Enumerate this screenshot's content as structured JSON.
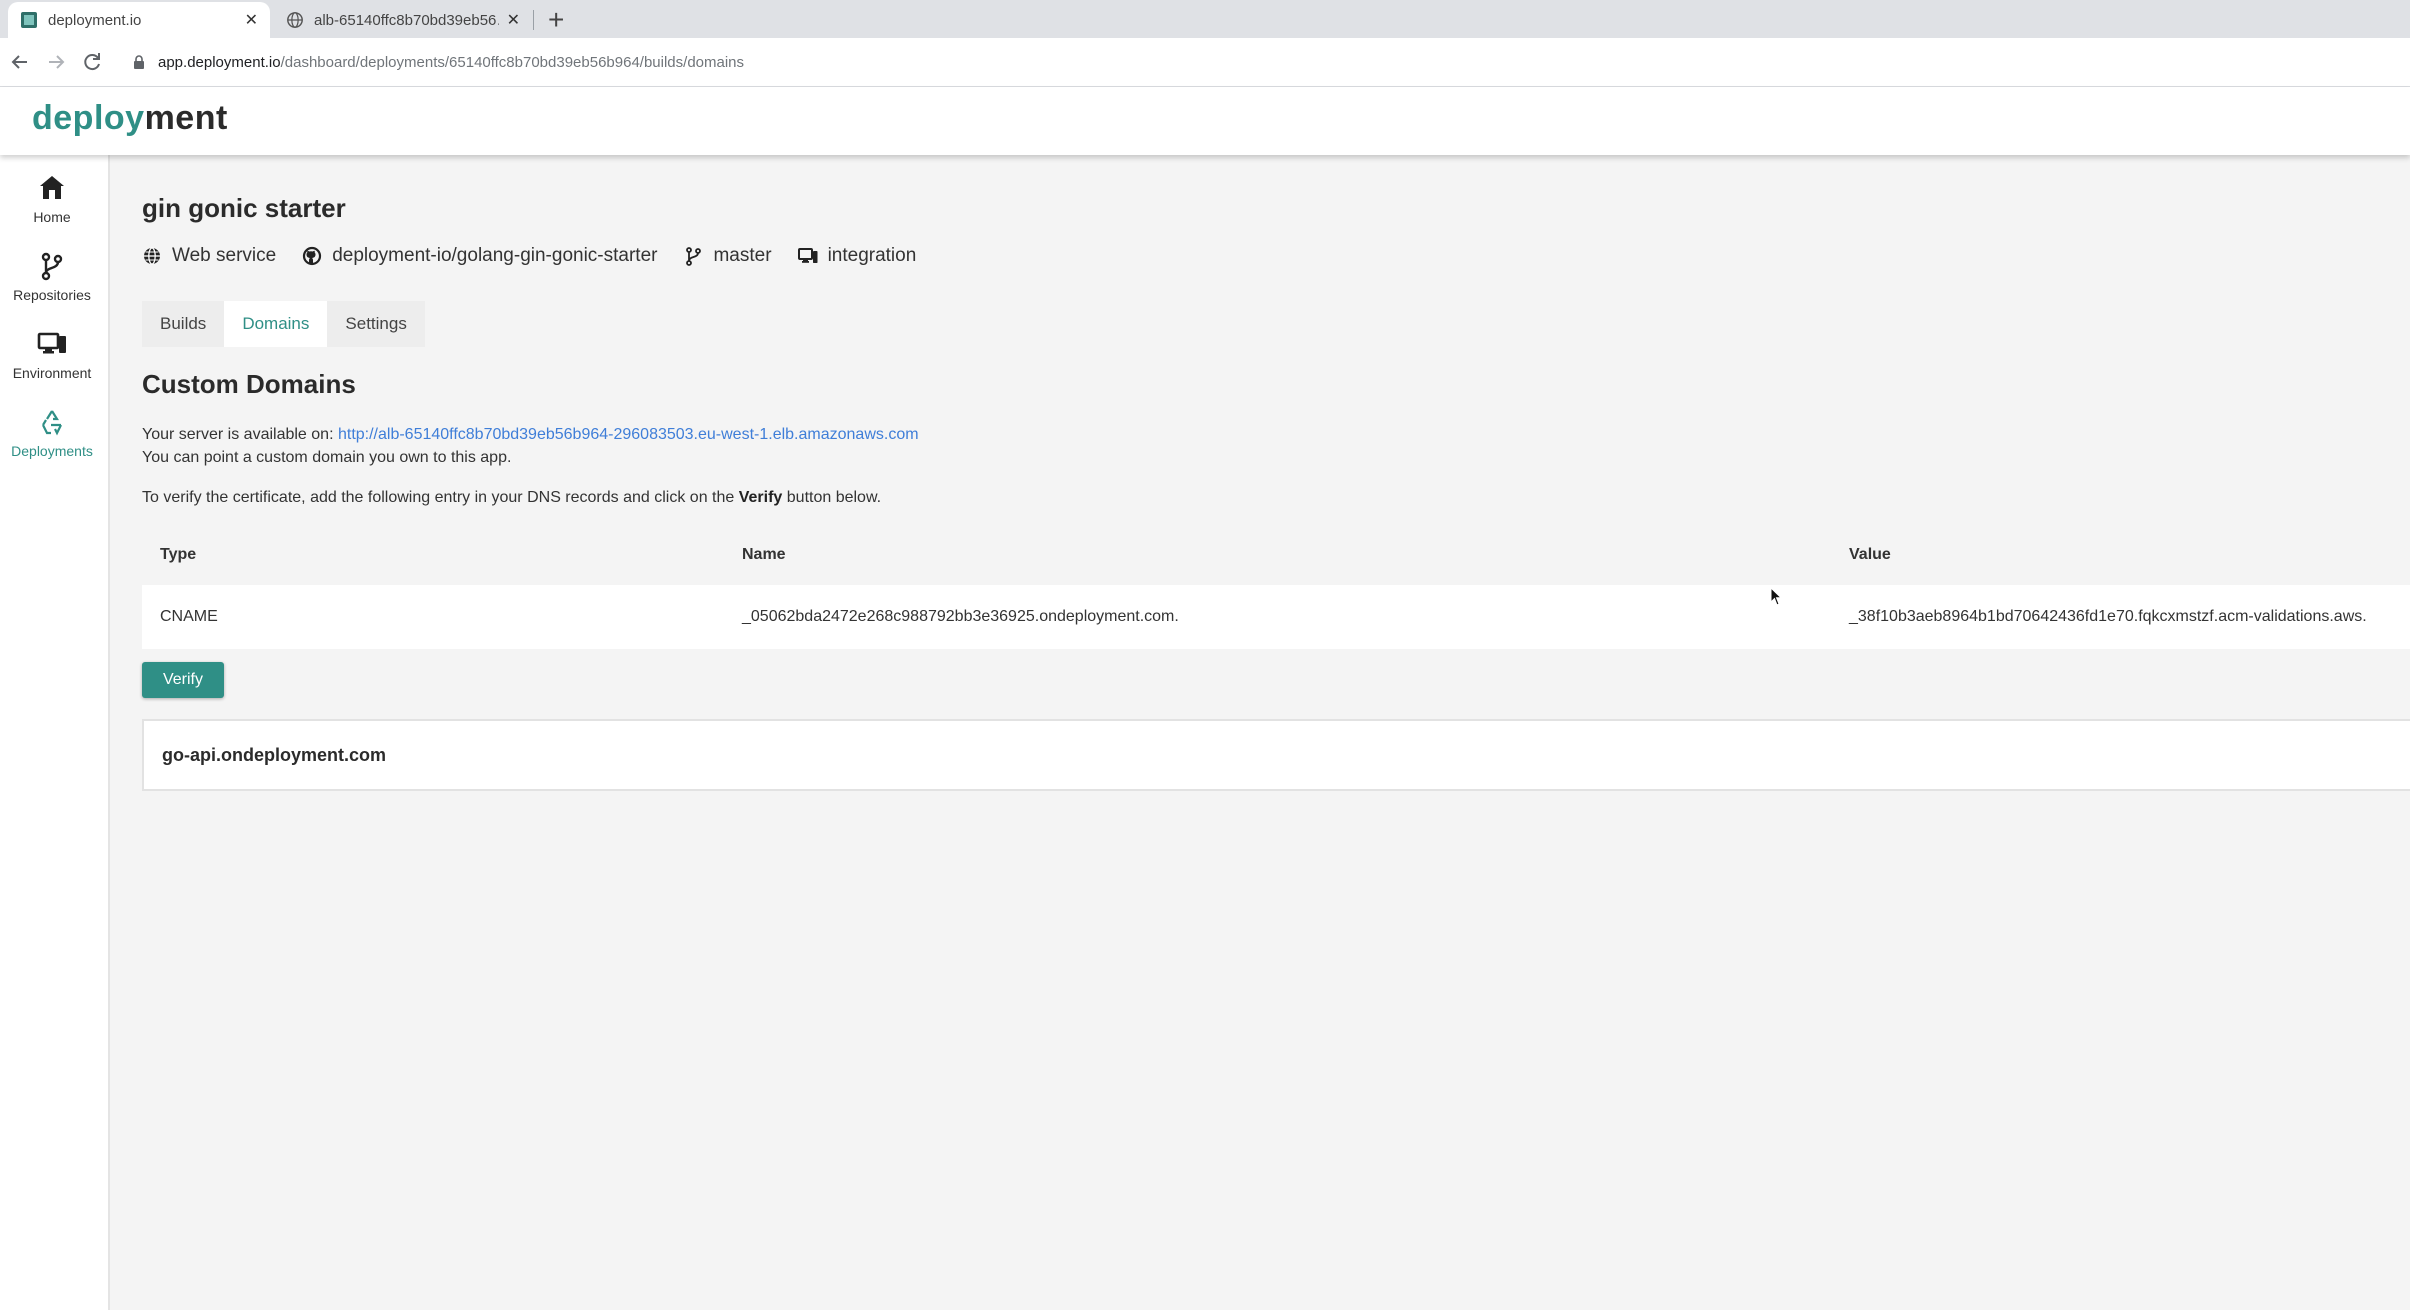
{
  "browser": {
    "tabs": [
      {
        "title": "deployment.io",
        "active": true
      },
      {
        "title": "alb-65140ffc8b70bd39eb56…",
        "active": false
      }
    ],
    "new_tab": "+",
    "url_host": "app.deployment.io",
    "url_path": "/dashboard/deployments/65140ffc8b70bd39eb56b964/builds/domains"
  },
  "brand": {
    "part1": "deploy",
    "part2": "ment",
    "accent_color": "#2f8f86"
  },
  "sidebar": {
    "items": [
      {
        "label": "Home",
        "icon": "home-icon"
      },
      {
        "label": "Repositories",
        "icon": "git-branch-icon"
      },
      {
        "label": "Environment",
        "icon": "devices-icon"
      },
      {
        "label": "Deployments",
        "icon": "recycle-icon",
        "active": true
      }
    ]
  },
  "project": {
    "title": "gin gonic starter",
    "meta": {
      "type": "Web service",
      "repo": "deployment-io/golang-gin-gonic-starter",
      "branch": "master",
      "environment": "integration"
    },
    "tabs": [
      "Builds",
      "Domains",
      "Settings"
    ],
    "active_tab": "Domains"
  },
  "custom_domains": {
    "title": "Custom Domains",
    "available_prefix": "Your server is available on: ",
    "server_url": "http://alb-65140ffc8b70bd39eb56b964-296083503.eu-west-1.elb.amazonaws.com",
    "point_text": "You can point a custom domain you own to this app.",
    "verify_prefix": "To verify the certificate, add the following entry in your DNS records and click on the ",
    "verify_bold": "Verify",
    "verify_suffix": " button below.",
    "table": {
      "headers": [
        "Type",
        "Name",
        "Value"
      ],
      "rows": [
        {
          "type": "CNAME",
          "name": "_05062bda2472e268c988792bb3e36925.ondeployment.com.",
          "value": "_38f10b3aeb8964b1bd70642436fd1e70.fqkcxmstzf.acm-validations.aws."
        }
      ]
    },
    "verify_button": "Verify",
    "domain": "go-api.ondeployment.com"
  }
}
